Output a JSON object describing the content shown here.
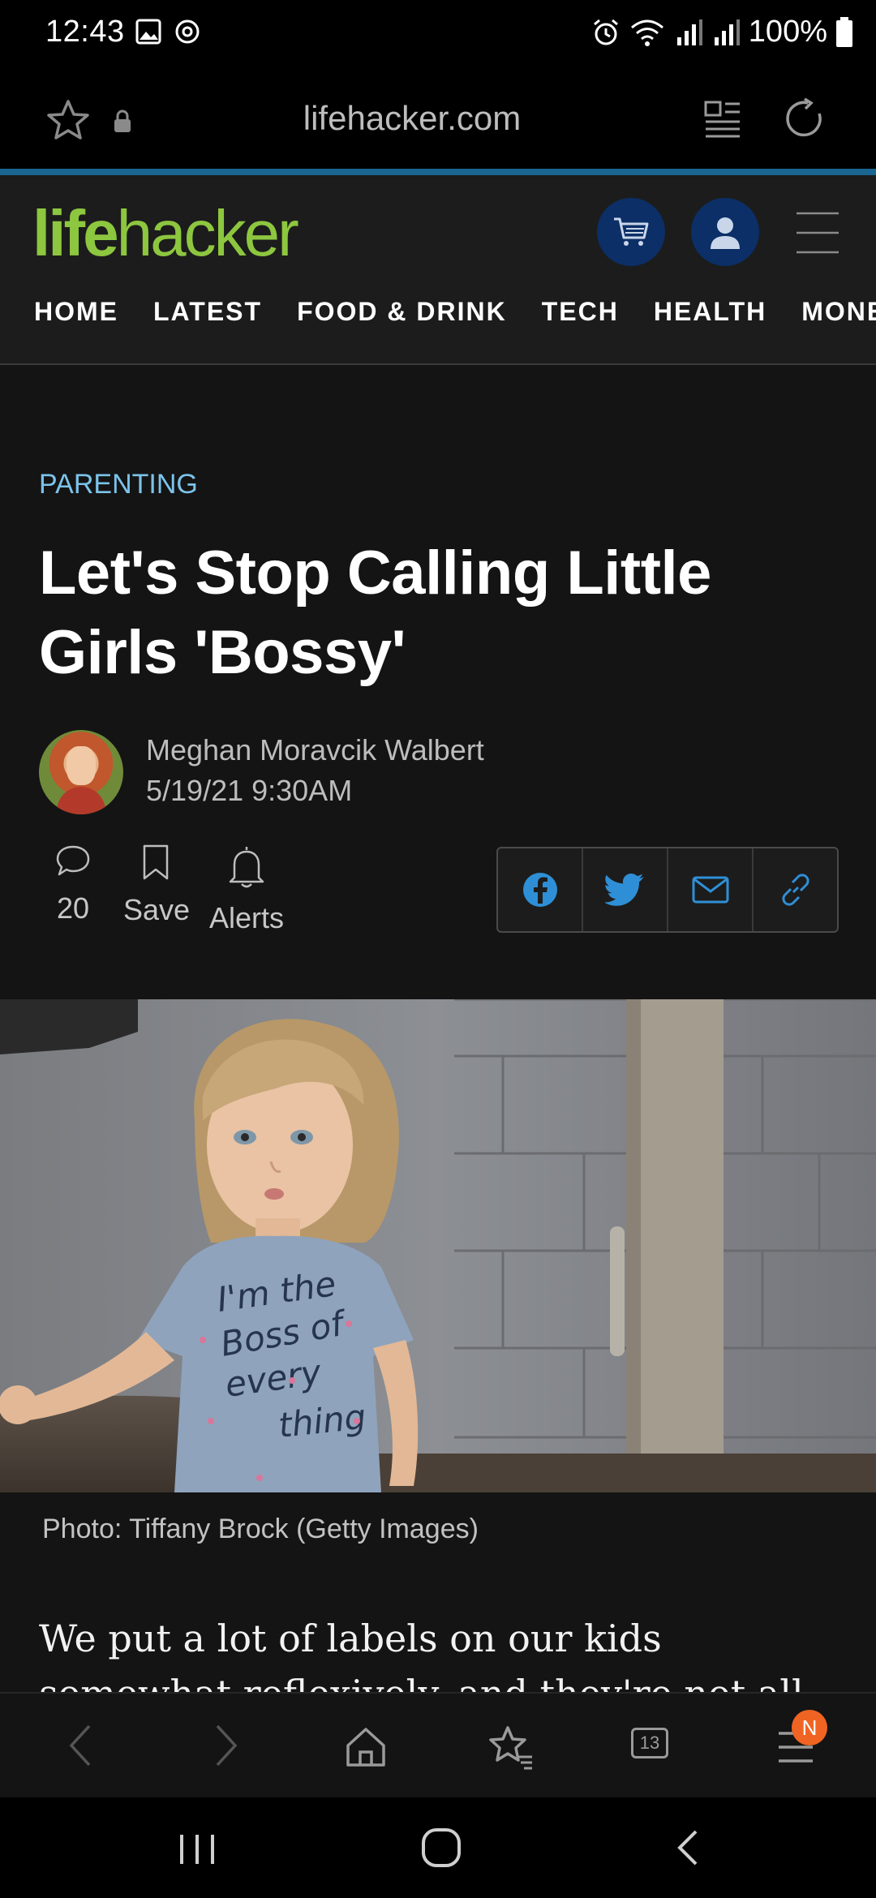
{
  "status_bar": {
    "time": "12:43",
    "battery": "100%"
  },
  "browser": {
    "url": "lifehacker.com",
    "tab_count": "13",
    "menu_badge": "N"
  },
  "site": {
    "logo_part1": "life",
    "logo_part2": "hacker",
    "nav": [
      "HOME",
      "LATEST",
      "FOOD & DRINK",
      "TECH",
      "HEALTH",
      "MONEY"
    ]
  },
  "article": {
    "category": "PARENTING",
    "headline": "Let's Stop Calling Little Girls 'Bossy'",
    "author": "Meghan Moravcik Walbert",
    "date": "5/19/21 9:30AM",
    "comments_count": "20",
    "save_label": "Save",
    "alerts_label": "Alerts",
    "photo_caption": "Photo: Tiffany Brock (Getty Images)",
    "shirt_text_1": "I'm the",
    "shirt_text_2": "Boss of",
    "shirt_text_3": "every",
    "shirt_text_4": "thing",
    "body": "We put a lot of labels on our kids somewhat reflexively, and they're not all good. We see an"
  },
  "colors": {
    "accent_line": "#1a6690",
    "logo_green": "#8dc63f",
    "category_blue": "#7cc3ea",
    "icon_circle": "#0b2f66",
    "badge_orange": "#f06423"
  }
}
